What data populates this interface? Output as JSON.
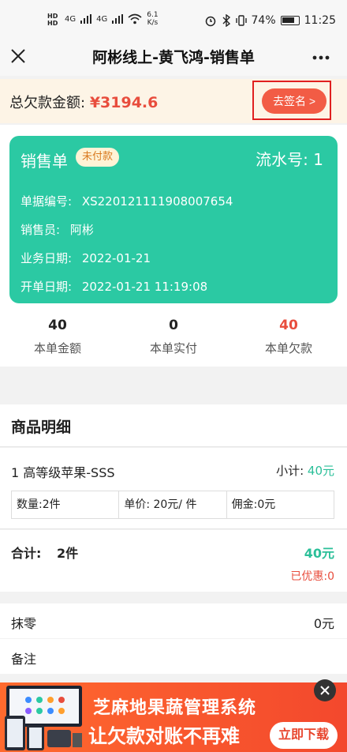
{
  "status_bar": {
    "network_speed": "6.1",
    "network_speed_unit": "K/s",
    "signal_1": "4G",
    "signal_2": "4G",
    "battery_percent": "74%",
    "time": "11:25"
  },
  "nav": {
    "title": "阿彬线上-黄飞鸿-销售单"
  },
  "debt": {
    "label": "总欠款金额:",
    "amount": "¥3194.6",
    "sign_button": "去签名 >"
  },
  "order_card": {
    "title": "销售单",
    "status_badge": "未付款",
    "serial": "流水号: 1",
    "doc_no_label": "单据编号:",
    "doc_no": "XS220121111908007654",
    "salesperson_label": "销售员:",
    "salesperson": "阿彬",
    "business_date_label": "业务日期:",
    "business_date": "2022-01-21",
    "open_date_label": "开单日期:",
    "open_date": "2022-01-21 11:19:08"
  },
  "stats": [
    {
      "value": "40",
      "label": "本单金额"
    },
    {
      "value": "0",
      "label": "本单实付"
    },
    {
      "value": "40",
      "label": "本单欠款"
    }
  ],
  "goods_section": {
    "title": "商品明细",
    "items": [
      {
        "name": "1 高等级苹果-SSS",
        "subtotal_label": "小计:",
        "subtotal": "40元",
        "qty": "数量:2件",
        "price": "单价: 20元/ 件",
        "commission": "佣金:0元"
      }
    ]
  },
  "total": {
    "label": "合计:",
    "count": "2件",
    "amount": "40元",
    "discount": "已优惠:0"
  },
  "rounding": {
    "label": "抹零",
    "value": "0元"
  },
  "remark": {
    "label": "备注"
  },
  "ad": {
    "line1": "芝麻地果蔬管理系统",
    "line2": "让欠款对账不再难",
    "button": "立即下载"
  },
  "colors": {
    "accent_green": "#2bc9a3",
    "alert_red": "#e84d3d",
    "sign_button": "#f25c45"
  }
}
